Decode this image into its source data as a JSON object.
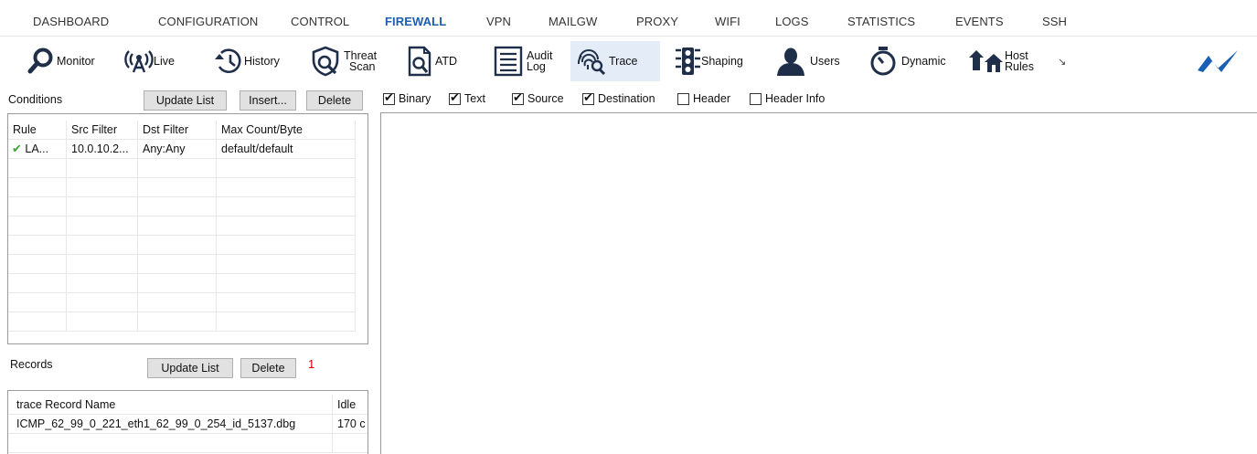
{
  "menu": {
    "items": [
      "DASHBOARD",
      "CONFIGURATION",
      "CONTROL",
      "FIREWALL",
      "VPN",
      "MAILGW",
      "PROXY",
      "WIFI",
      "LOGS",
      "STATISTICS",
      "EVENTS",
      "SSH"
    ],
    "active": "FIREWALL"
  },
  "toolbar": {
    "monitor": "Monitor",
    "live": "Live",
    "history": "History",
    "threat_scan_1": "Threat",
    "threat_scan_2": "Scan",
    "atd": "ATD",
    "audit_log_1": "Audit",
    "audit_log_2": "Log",
    "trace": "Trace",
    "shaping": "Shaping",
    "users": "Users",
    "dynamic": "Dynamic",
    "host_rules_1": "Host",
    "host_rules_2": "Rules",
    "selected": "Trace",
    "brand_color": "#1a5fb4"
  },
  "conditions": {
    "label": "Conditions",
    "update_list": "Update List",
    "insert": "Insert...",
    "delete": "Delete",
    "columns": [
      "Rule",
      "Src Filter",
      "Dst Filter",
      "Max Count/Byte"
    ],
    "rows": [
      {
        "rule": "LA...",
        "src": "10.0.10.2...",
        "dst": "Any:Any",
        "max": "default/default",
        "status": "check-icon"
      }
    ]
  },
  "display_options": {
    "binary": {
      "label": "Binary",
      "checked": true
    },
    "text": {
      "label": "Text",
      "checked": true
    },
    "source": {
      "label": "Source",
      "checked": true
    },
    "destination": {
      "label": "Destination",
      "checked": true
    },
    "header": {
      "label": "Header",
      "checked": false
    },
    "header_info": {
      "label": "Header Info",
      "checked": false
    }
  },
  "records": {
    "label": "Records",
    "update_list": "Update List",
    "delete": "Delete",
    "count": "1",
    "columns": [
      "trace Record Name",
      "Idle"
    ],
    "rows": [
      {
        "name": "ICMP_62_99_0_221_eth1_62_99_0_254_id_5137.dbg",
        "idle": "170 c"
      }
    ]
  }
}
